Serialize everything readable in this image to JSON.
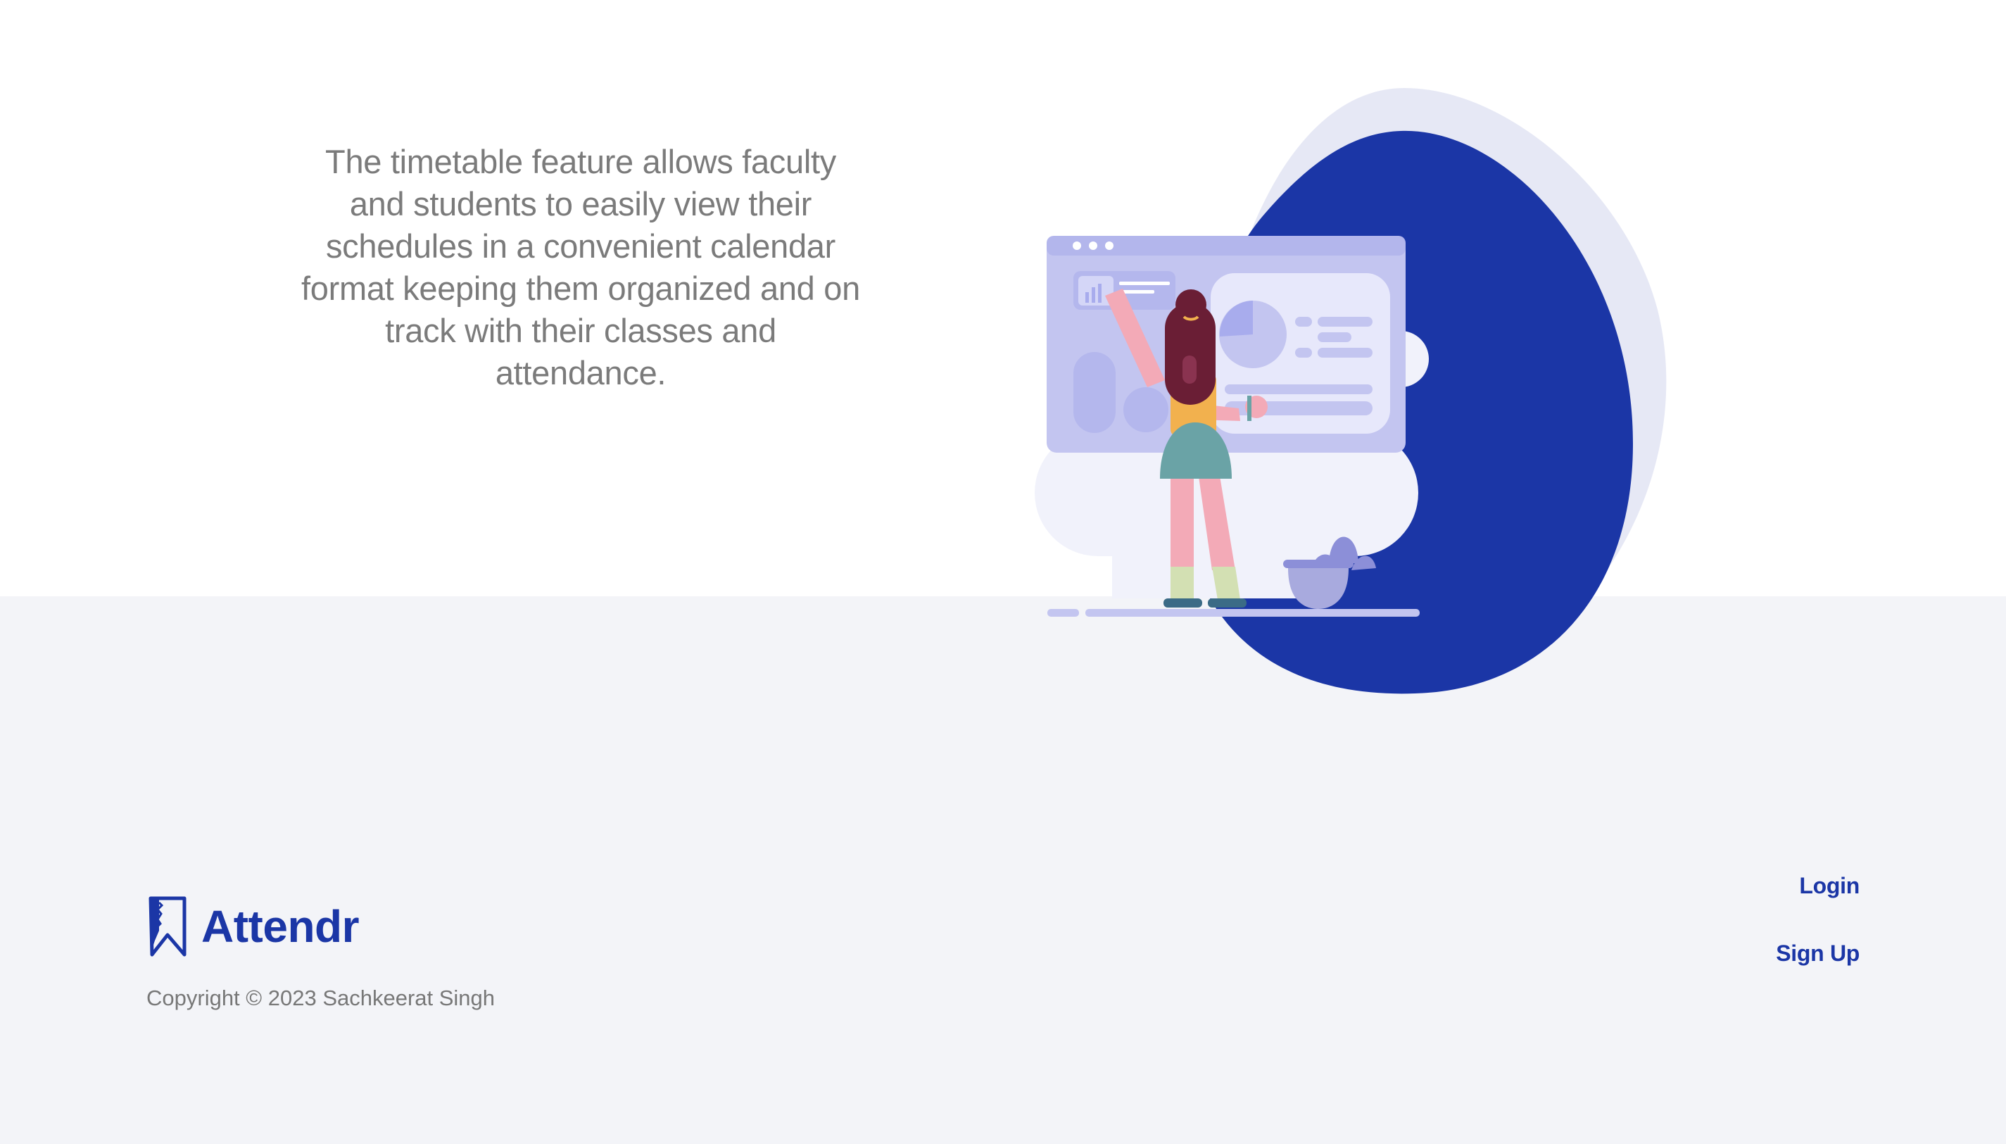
{
  "feature": {
    "description": "The timetable feature allows faculty and students to easily view their schedules in a convenient calendar format keeping them organized and on track with their classes and attendance."
  },
  "illustration": {
    "icon": "woman-at-dashboard-illustration"
  },
  "footer": {
    "brand_name": "Attendr",
    "logo_icon": "bookmark-logo-icon",
    "copyright": "Copyright © 2023 Sachkeerat Singh",
    "links": {
      "login": "Login",
      "signup": "Sign Up"
    }
  },
  "colors": {
    "brand": "#1b36a6",
    "blob_light": "#e6e8f5",
    "footer_bg": "#f3f4f8",
    "text_muted": "#7b7b7b"
  }
}
